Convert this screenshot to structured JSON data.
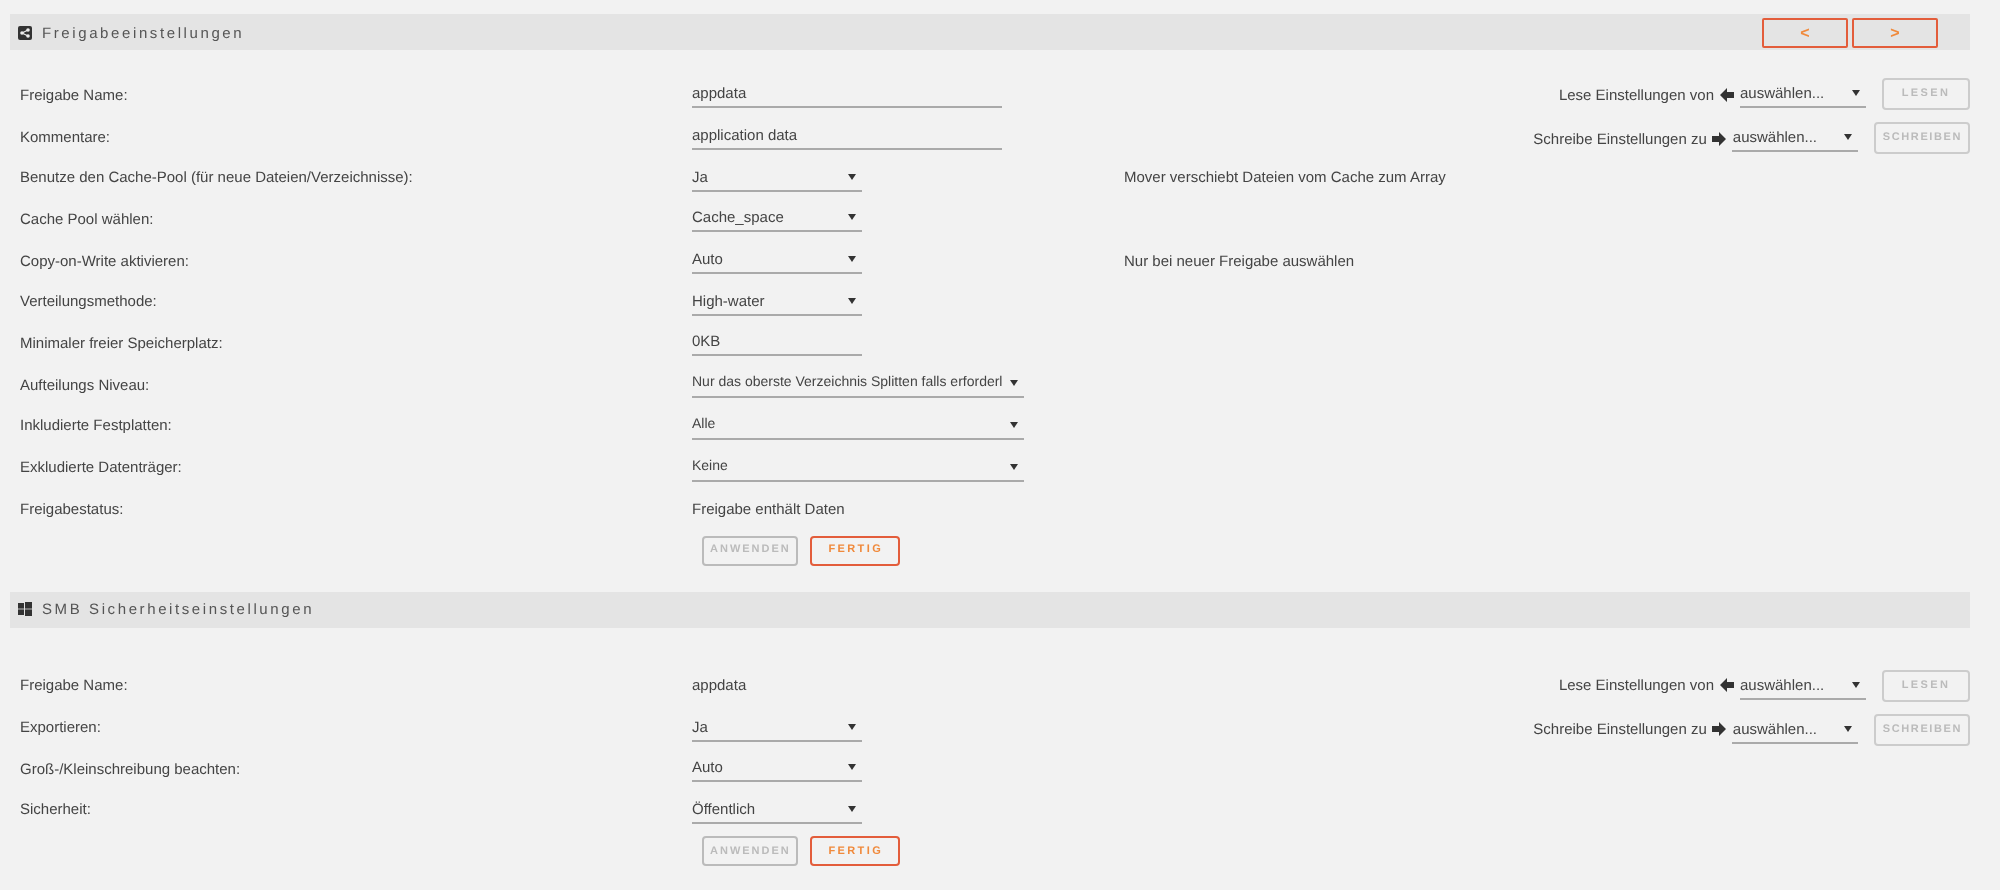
{
  "sections": [
    {
      "title": "Freigabeeinstellungen",
      "nav": [
        {
          "label": "<"
        },
        {
          "label": ">"
        }
      ],
      "rows": [
        {
          "label": "Freigabe Name:",
          "kind": "text-wide",
          "value": "appdata"
        },
        {
          "label": "Kommentare:",
          "kind": "text-wide",
          "value": "application data"
        },
        {
          "label": "Benutze den Cache-Pool (für neue Dateien/Verzeichnisse):",
          "kind": "select",
          "value": "Ja",
          "note": "Mover verschiebt Dateien vom Cache zum Array"
        },
        {
          "label": "Cache Pool wählen:",
          "kind": "select",
          "value": "Cache_space"
        },
        {
          "label": "Copy-on-Write aktivieren:",
          "kind": "select",
          "value": "Auto",
          "note": "Nur bei neuer Freigabe auswählen"
        },
        {
          "label": "Verteilungsmethode:",
          "kind": "select",
          "value": "High-water"
        },
        {
          "label": "Minimaler freier Speicherplatz:",
          "kind": "text",
          "value": "0KB"
        },
        {
          "label": "Aufteilungs Niveau:",
          "kind": "select-wide",
          "value": "Nur das oberste Verzeichnis Splitten falls erforderl"
        },
        {
          "label": "Inkludierte Festplatten:",
          "kind": "select-wide",
          "value": "Alle"
        },
        {
          "label": "Exkludierte Datenträger:",
          "kind": "select-wide",
          "value": "Keine"
        },
        {
          "label": "Freigabestatus:",
          "kind": "static",
          "value": "Freigabe enthält Daten"
        }
      ],
      "buttons": [
        {
          "label": "ANWENDEN",
          "disabled": true
        },
        {
          "label": "FERTIG",
          "disabled": false
        }
      ],
      "tools": [
        {
          "label": "Lese Einstellungen von",
          "kind": "read",
          "value": "auswählen...",
          "button": "LESEN"
        },
        {
          "label": "Schreibe Einstellungen zu",
          "kind": "write",
          "value": "auswählen...",
          "button": "SCHREIBEN"
        }
      ]
    },
    {
      "title": "SMB Sicherheitseinstellungen",
      "rows": [
        {
          "label": "Freigabe Name:",
          "kind": "static",
          "value": "appdata"
        },
        {
          "label": "Exportieren:",
          "kind": "select",
          "value": "Ja"
        },
        {
          "label": "Groß-/Kleinschreibung beachten:",
          "kind": "select",
          "value": "Auto"
        },
        {
          "label": "Sicherheit:",
          "kind": "select",
          "value": "Öffentlich"
        }
      ],
      "buttons": [
        {
          "label": "ANWENDEN",
          "disabled": true
        },
        {
          "label": "FERTIG",
          "disabled": false
        }
      ],
      "tools": [
        {
          "label": "Lese Einstellungen von",
          "kind": "read",
          "value": "auswählen...",
          "button": "LESEN"
        },
        {
          "label": "Schreibe Einstellungen zu",
          "kind": "write",
          "value": "auswählen...",
          "button": "SCHREIBEN"
        }
      ]
    }
  ]
}
